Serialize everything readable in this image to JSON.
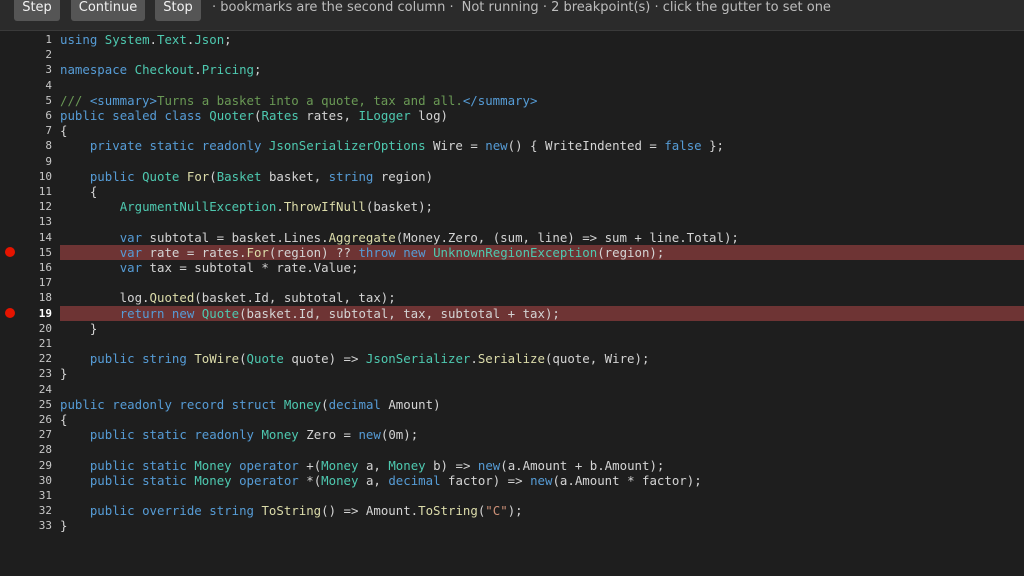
{
  "toolbar": {
    "step_label": "Step",
    "continue_label": "Continue",
    "stop_label": "Stop",
    "status_hint": "· bookmarks are the second column ·",
    "status_run": "Not running · 2 breakpoint(s) · click the gutter to set one"
  },
  "colors": {
    "breakpoint_dot": "#e51400",
    "breakpoint_line": "#6e3434",
    "editor_bg": "#1e1e1e",
    "keyword": "#569cd6",
    "type": "#4ec9b0",
    "method": "#dcdcaa",
    "comment": "#6a9955",
    "string": "#ce9178"
  },
  "editor": {
    "current_line": 19,
    "breakpoints": [
      15,
      19
    ],
    "lines": [
      [
        [
          "k",
          "using"
        ],
        [
          "p",
          " "
        ],
        [
          "t",
          "System"
        ],
        [
          "p",
          "."
        ],
        [
          "t",
          "Text"
        ],
        [
          "p",
          "."
        ],
        [
          "t",
          "Json"
        ],
        [
          "p",
          ";"
        ]
      ],
      [],
      [
        [
          "k",
          "namespace"
        ],
        [
          "p",
          " "
        ],
        [
          "t",
          "Checkout"
        ],
        [
          "p",
          "."
        ],
        [
          "t",
          "Pricing"
        ],
        [
          "p",
          ";"
        ]
      ],
      [],
      [
        [
          "c",
          "/// "
        ],
        [
          "k",
          "<summary>"
        ],
        [
          "c",
          "Turns a basket into a quote, tax and all."
        ],
        [
          "k",
          "</summary>"
        ]
      ],
      [
        [
          "k",
          "public"
        ],
        [
          "p",
          " "
        ],
        [
          "k",
          "sealed"
        ],
        [
          "p",
          " "
        ],
        [
          "k",
          "class"
        ],
        [
          "p",
          " "
        ],
        [
          "t",
          "Quoter"
        ],
        [
          "p",
          "("
        ],
        [
          "t",
          "Rates"
        ],
        [
          "p",
          " rates, "
        ],
        [
          "t",
          "ILogger"
        ],
        [
          "p",
          " log)"
        ]
      ],
      [
        [
          "p",
          "{"
        ]
      ],
      [
        [
          "p",
          "    "
        ],
        [
          "k",
          "private"
        ],
        [
          "p",
          " "
        ],
        [
          "k",
          "static"
        ],
        [
          "p",
          " "
        ],
        [
          "k",
          "readonly"
        ],
        [
          "p",
          " "
        ],
        [
          "t",
          "JsonSerializerOptions"
        ],
        [
          "p",
          " Wire = "
        ],
        [
          "k",
          "new"
        ],
        [
          "p",
          "() { WriteIndented = "
        ],
        [
          "k",
          "false"
        ],
        [
          "p",
          " };"
        ]
      ],
      [],
      [
        [
          "p",
          "    "
        ],
        [
          "k",
          "public"
        ],
        [
          "p",
          " "
        ],
        [
          "t",
          "Quote"
        ],
        [
          "p",
          " "
        ],
        [
          "m",
          "For"
        ],
        [
          "p",
          "("
        ],
        [
          "t",
          "Basket"
        ],
        [
          "p",
          " basket, "
        ],
        [
          "k",
          "string"
        ],
        [
          "p",
          " region)"
        ]
      ],
      [
        [
          "p",
          "    {"
        ]
      ],
      [
        [
          "p",
          "        "
        ],
        [
          "t",
          "ArgumentNullException"
        ],
        [
          "p",
          "."
        ],
        [
          "m",
          "ThrowIfNull"
        ],
        [
          "p",
          "(basket);"
        ]
      ],
      [],
      [
        [
          "p",
          "        "
        ],
        [
          "k",
          "var"
        ],
        [
          "p",
          " subtotal = basket.Lines."
        ],
        [
          "m",
          "Aggregate"
        ],
        [
          "p",
          "(Money.Zero, (sum, line) => sum + line.Total);"
        ]
      ],
      [
        [
          "p",
          "        "
        ],
        [
          "k",
          "var"
        ],
        [
          "p",
          " rate = rates."
        ],
        [
          "m",
          "For"
        ],
        [
          "p",
          "(region) ?? "
        ],
        [
          "k",
          "throw"
        ],
        [
          "p",
          " "
        ],
        [
          "k",
          "new"
        ],
        [
          "p",
          " "
        ],
        [
          "t",
          "UnknownRegionException"
        ],
        [
          "p",
          "(region);"
        ]
      ],
      [
        [
          "p",
          "        "
        ],
        [
          "k",
          "var"
        ],
        [
          "p",
          " tax = subtotal * rate.Value;"
        ]
      ],
      [],
      [
        [
          "p",
          "        log."
        ],
        [
          "m",
          "Quoted"
        ],
        [
          "p",
          "(basket.Id, subtotal, tax);"
        ]
      ],
      [
        [
          "p",
          "        "
        ],
        [
          "k",
          "return"
        ],
        [
          "p",
          " "
        ],
        [
          "k",
          "new"
        ],
        [
          "p",
          " "
        ],
        [
          "t",
          "Quote"
        ],
        [
          "p",
          "(basket.Id, subtotal, tax, subtotal + tax);"
        ]
      ],
      [
        [
          "p",
          "    }"
        ]
      ],
      [],
      [
        [
          "p",
          "    "
        ],
        [
          "k",
          "public"
        ],
        [
          "p",
          " "
        ],
        [
          "k",
          "string"
        ],
        [
          "p",
          " "
        ],
        [
          "m",
          "ToWire"
        ],
        [
          "p",
          "("
        ],
        [
          "t",
          "Quote"
        ],
        [
          "p",
          " quote) => "
        ],
        [
          "t",
          "JsonSerializer"
        ],
        [
          "p",
          "."
        ],
        [
          "m",
          "Serialize"
        ],
        [
          "p",
          "(quote, Wire);"
        ]
      ],
      [
        [
          "p",
          "}"
        ]
      ],
      [],
      [
        [
          "k",
          "public"
        ],
        [
          "p",
          " "
        ],
        [
          "k",
          "readonly"
        ],
        [
          "p",
          " "
        ],
        [
          "k",
          "record"
        ],
        [
          "p",
          " "
        ],
        [
          "k",
          "struct"
        ],
        [
          "p",
          " "
        ],
        [
          "t",
          "Money"
        ],
        [
          "p",
          "("
        ],
        [
          "k",
          "decimal"
        ],
        [
          "p",
          " Amount)"
        ]
      ],
      [
        [
          "p",
          "{"
        ]
      ],
      [
        [
          "p",
          "    "
        ],
        [
          "k",
          "public"
        ],
        [
          "p",
          " "
        ],
        [
          "k",
          "static"
        ],
        [
          "p",
          " "
        ],
        [
          "k",
          "readonly"
        ],
        [
          "p",
          " "
        ],
        [
          "t",
          "Money"
        ],
        [
          "p",
          " Zero = "
        ],
        [
          "k",
          "new"
        ],
        [
          "p",
          "(0m);"
        ]
      ],
      [],
      [
        [
          "p",
          "    "
        ],
        [
          "k",
          "public"
        ],
        [
          "p",
          " "
        ],
        [
          "k",
          "static"
        ],
        [
          "p",
          " "
        ],
        [
          "t",
          "Money"
        ],
        [
          "p",
          " "
        ],
        [
          "k",
          "operator"
        ],
        [
          "p",
          " +("
        ],
        [
          "t",
          "Money"
        ],
        [
          "p",
          " a, "
        ],
        [
          "t",
          "Money"
        ],
        [
          "p",
          " b) => "
        ],
        [
          "k",
          "new"
        ],
        [
          "p",
          "(a.Amount + b.Amount);"
        ]
      ],
      [
        [
          "p",
          "    "
        ],
        [
          "k",
          "public"
        ],
        [
          "p",
          " "
        ],
        [
          "k",
          "static"
        ],
        [
          "p",
          " "
        ],
        [
          "t",
          "Money"
        ],
        [
          "p",
          " "
        ],
        [
          "k",
          "operator"
        ],
        [
          "p",
          " *("
        ],
        [
          "t",
          "Money"
        ],
        [
          "p",
          " a, "
        ],
        [
          "k",
          "decimal"
        ],
        [
          "p",
          " factor) => "
        ],
        [
          "k",
          "new"
        ],
        [
          "p",
          "(a.Amount * factor);"
        ]
      ],
      [],
      [
        [
          "p",
          "    "
        ],
        [
          "k",
          "public"
        ],
        [
          "p",
          " "
        ],
        [
          "k",
          "override"
        ],
        [
          "p",
          " "
        ],
        [
          "k",
          "string"
        ],
        [
          "p",
          " "
        ],
        [
          "m",
          "ToString"
        ],
        [
          "p",
          "() => Amount."
        ],
        [
          "m",
          "ToString"
        ],
        [
          "p",
          "("
        ],
        [
          "s",
          "\"C\""
        ],
        [
          "p",
          ");"
        ]
      ],
      [
        [
          "p",
          "}"
        ]
      ]
    ]
  }
}
